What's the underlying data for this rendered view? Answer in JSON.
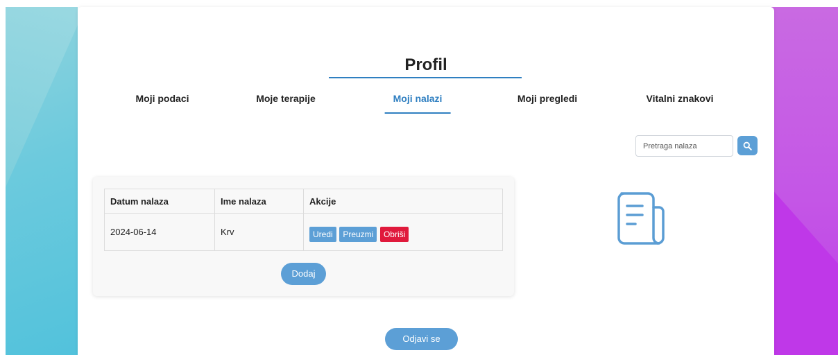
{
  "page": {
    "title": "Profil"
  },
  "tabs": [
    {
      "label": "Moji podaci",
      "active": false
    },
    {
      "label": "Moje terapije",
      "active": false
    },
    {
      "label": "Moji nalazi",
      "active": true
    },
    {
      "label": "Moji pregledi",
      "active": false
    },
    {
      "label": "Vitalni znakovi",
      "active": false
    }
  ],
  "search": {
    "placeholder": "Pretraga nalaza",
    "value": "",
    "button_icon": "search-icon"
  },
  "table": {
    "headers": [
      "Datum nalaza",
      "Ime nalaza",
      "Akcije"
    ],
    "rows": [
      {
        "date": "2024-06-14",
        "name": "Krv",
        "actions": {
          "edit": "Uredi",
          "download": "Preuzmi",
          "delete": "Obriši"
        }
      }
    ]
  },
  "add_button": "Dodaj",
  "logout_button": "Odjavi se",
  "illustration": {
    "icon": "document-icon"
  },
  "colors": {
    "accent": "#2f7fc1",
    "button": "#5c9fd6",
    "danger": "#e01a3c",
    "bg_left": "#52c2dc",
    "bg_right": "#bd3ee8"
  }
}
